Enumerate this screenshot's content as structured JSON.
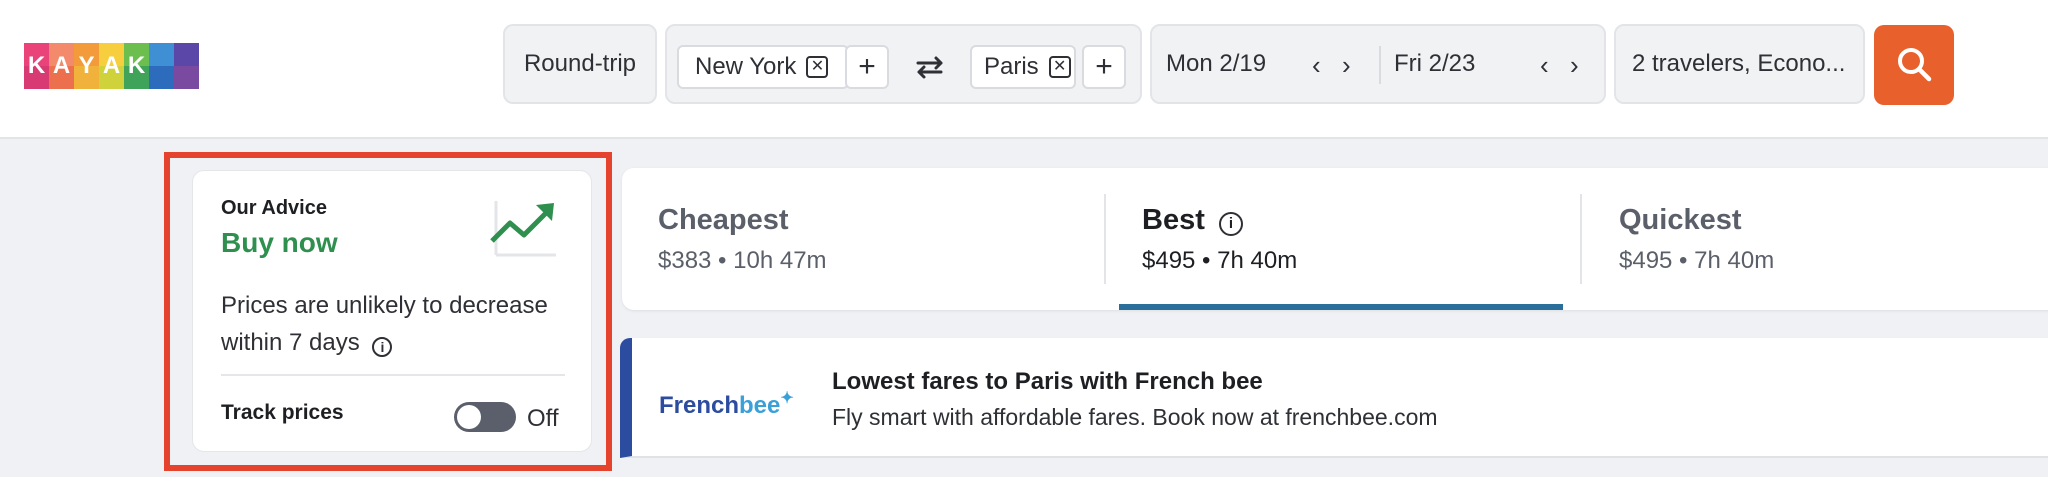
{
  "logo": {
    "letters": [
      "K",
      "A",
      "Y",
      "A",
      "K"
    ]
  },
  "search": {
    "trip_type": "Round-trip",
    "origin": "New York",
    "destination": "Paris",
    "depart_date": "Mon 2/19",
    "return_date": "Fri 2/23",
    "travelers": "2 travelers, Econo..."
  },
  "advice": {
    "heading": "Our Advice",
    "recommendation": "Buy now",
    "message_line1": "Prices are unlikely to decrease",
    "message_line2": "within 7 days",
    "track_label": "Track prices",
    "toggle_state": "Off"
  },
  "sort_tabs": [
    {
      "title": "Cheapest",
      "price": "$383",
      "duration": "10h 47m"
    },
    {
      "title": "Best",
      "price": "$495",
      "duration": "7h 40m"
    },
    {
      "title": "Quickest",
      "price": "$495",
      "duration": "7h 40m"
    }
  ],
  "ad": {
    "brand_part1": "French",
    "brand_part2": "bee",
    "headline": "Lowest fares to Paris with French bee",
    "body": "Fly smart with affordable fares. Book now at frenchbee.com"
  },
  "colors": {
    "accent_orange": "#e8602c",
    "advice_green": "#2f8f4e",
    "highlight_red": "#e5432e",
    "tab_underline": "#2a6f9a",
    "ad_bar": "#2c4ca0"
  },
  "icons": [
    "swap-icon",
    "search-icon",
    "trend-up-icon",
    "info-icon",
    "clear-icon",
    "plus-icon",
    "chevron-left-icon",
    "chevron-right-icon"
  ]
}
